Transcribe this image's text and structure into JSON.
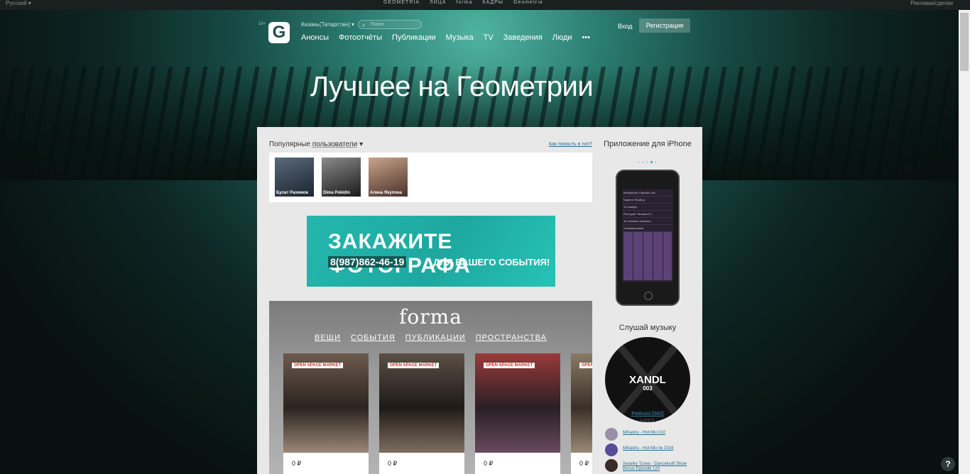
{
  "topbar": {
    "language": "Русский ▾",
    "ads_link": "Реклама/сделки",
    "brands": [
      "GEOMETRIA",
      "ЛИЦА",
      "forma",
      "КАДРЫ",
      "Geometria"
    ]
  },
  "header": {
    "logo_text": "G",
    "logo_badge": "16+",
    "city": "Казань(Татарстан) ▾",
    "search_placeholder": "Поиск",
    "menu": [
      "Анонсы",
      "Фотоотчёты",
      "Публикации",
      "Музыка",
      "TV",
      "Заведения",
      "Люди",
      "•••"
    ],
    "login": "Вход",
    "register": "Регистрация"
  },
  "page": {
    "title": "Лучшее на Геометрии"
  },
  "popular": {
    "label": "Популярные",
    "selector": "пользователи",
    "how_link": "Как попасть в топ?",
    "users": [
      {
        "name": "Булат Рахимов",
        "color": "#3a4a5a"
      },
      {
        "name": "Dima Pokidin",
        "color": "#4a4a4a"
      },
      {
        "name": "Алена Якупова",
        "color": "#8a6a5a"
      }
    ]
  },
  "banner": {
    "line1": "ЗАКАЖИТЕ ФОТОГРАФА",
    "phone": "8(987)862-46-19",
    "line2": "ДЛЯ ВАШЕГО СОБЫТИЯ!"
  },
  "forma": {
    "logo": "forma",
    "tabs": [
      "ВЕЩИ",
      "СОБЫТИЯ",
      "ПУБЛИКАЦИИ",
      "ПРОСТРАНСТВА"
    ],
    "cards": [
      {
        "tag": "OPEN SPACE MARKET",
        "price": "0 ₽"
      },
      {
        "tag": "OPEN SPACE MARKET",
        "price": "0 ₽"
      },
      {
        "tag": "OPEN SPACE MARKET",
        "price": "0 ₽"
      },
      {
        "tag": "OPEN",
        "price": "0 ₽"
      }
    ]
  },
  "sidebar": {
    "app_title": "Приложение для iPhone",
    "phone_rows": [
      "Вечеринка «Special Cas...",
      "Daytime Rooftop",
      "13 ноября",
      "Ресторан \"Москва-Сi...",
      "10 человек посетили",
      "3 комментария"
    ],
    "music_title": "Слушай музыку",
    "album_brand": "XANDL",
    "album_num": "003",
    "podcast_title": "Podcast [003]",
    "podcast_sub": "XANDL",
    "tracks": [
      "Mihashu - Hot Mix 010",
      "Mihashu - Hot Mix № 2016",
      "Swanky Tunes - Dancekraft Show Bonus Episode 124"
    ]
  },
  "help_label": "?"
}
